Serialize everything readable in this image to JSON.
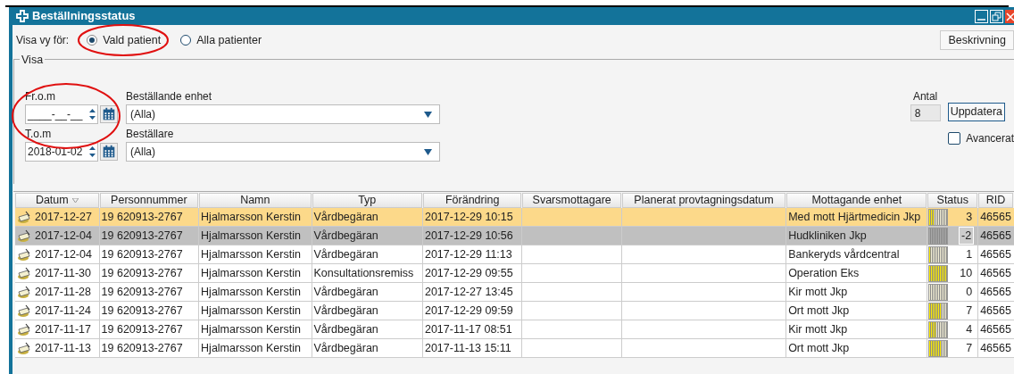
{
  "window": {
    "title": "Beställningsstatus"
  },
  "view_for": {
    "label": "Visa vy för:",
    "options": [
      {
        "label": "Vald patient",
        "selected": true
      },
      {
        "label": "Alla patienter",
        "selected": false
      }
    ]
  },
  "description_button": "Beskrivning",
  "filter": {
    "legend": "Visa",
    "from": {
      "label": "Fr.o.m",
      "value": "____-__-__"
    },
    "to": {
      "label": "T.o.m",
      "value": "2018-01-02"
    },
    "ordering_unit": {
      "label": "Beställande enhet",
      "value": "(Alla)"
    },
    "orderer": {
      "label": "Beställare",
      "value": "(Alla)"
    },
    "count": {
      "label": "Antal",
      "value": "8"
    },
    "update_button": "Uppdatera",
    "advanced": {
      "label": "Avancerat",
      "checked": false
    }
  },
  "table": {
    "columns": [
      "Datum",
      "Personnummer",
      "Namn",
      "Typ",
      "Förändring",
      "Svarsmottagare",
      "Planerat provtagningsdatum",
      "Mottagande enhet",
      "Status",
      "RID"
    ],
    "rows": [
      {
        "selected": true,
        "greyed": false,
        "cells": [
          "2017-12-27",
          "19 620913-2767",
          "Hjalmarsson Kerstin",
          "Vårdbegäran",
          "2017-12-29 10:15",
          "",
          "",
          "Med mott Hjärtmedicin Jkp"
        ],
        "status": "3",
        "level": 0.3,
        "rid": "46565"
      },
      {
        "selected": false,
        "greyed": true,
        "cells": [
          "2017-12-04",
          "19 620913-2767",
          "Hjalmarsson Kerstin",
          "Vårdbegäran",
          "2017-12-29 10:56",
          "",
          "",
          "Hudkliniken Jkp"
        ],
        "status": "-2",
        "level": 0,
        "rid": "46565"
      },
      {
        "selected": false,
        "greyed": false,
        "cells": [
          "2017-12-04",
          "19 620913-2767",
          "Hjalmarsson Kerstin",
          "Vårdbegäran",
          "2017-12-29 11:13",
          "",
          "",
          "Bankeryds vårdcentral"
        ],
        "status": "1",
        "level": 0.1,
        "rid": "46565"
      },
      {
        "selected": false,
        "greyed": false,
        "cells": [
          "2017-11-30",
          "19 620913-2767",
          "Hjalmarsson Kerstin",
          "Konsultationsremiss",
          "2017-12-29 09:55",
          "",
          "",
          "Operation Eks"
        ],
        "status": "10",
        "level": 1,
        "rid": "46565"
      },
      {
        "selected": false,
        "greyed": false,
        "cells": [
          "2017-11-28",
          "19 620913-2767",
          "Hjalmarsson Kerstin",
          "Vårdbegäran",
          "2017-12-27 13:45",
          "",
          "",
          "Kir mott Jkp"
        ],
        "status": "0",
        "level": 0,
        "rid": "46565"
      },
      {
        "selected": false,
        "greyed": false,
        "cells": [
          "2017-11-24",
          "19 620913-2767",
          "Hjalmarsson Kerstin",
          "Vårdbegäran",
          "2017-12-29 09:59",
          "",
          "",
          "Ort mott Jkp"
        ],
        "status": "7",
        "level": 0.7,
        "rid": "46565"
      },
      {
        "selected": false,
        "greyed": false,
        "cells": [
          "2017-11-17",
          "19 620913-2767",
          "Hjalmarsson Kerstin",
          "Vårdbegäran",
          "2017-11-17 08:51",
          "",
          "",
          "Kir mott Jkp"
        ],
        "status": "4",
        "level": 0.4,
        "rid": "46565"
      },
      {
        "selected": false,
        "greyed": false,
        "cells": [
          "2017-11-13",
          "19 620913-2767",
          "Hjalmarsson Kerstin",
          "Vårdbegäran",
          "2017-11-13 15:11",
          "",
          "",
          "Ort mott Jkp"
        ],
        "status": "7",
        "level": 0.7,
        "rid": "46565"
      }
    ]
  }
}
